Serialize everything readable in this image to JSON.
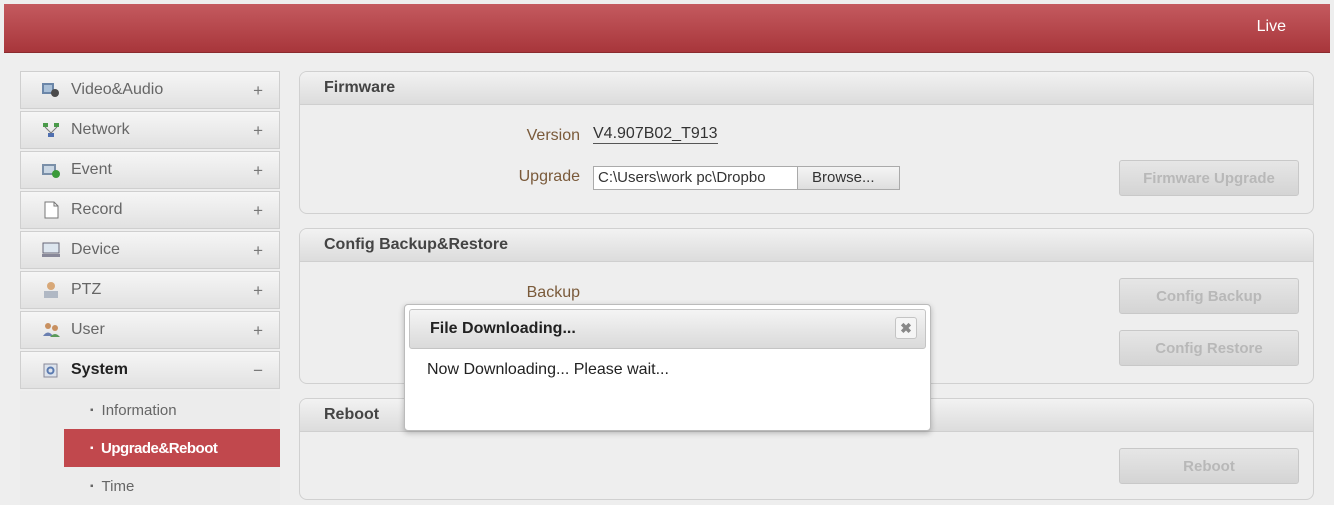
{
  "topbar": {
    "live_label": "Live"
  },
  "sidebar": {
    "items": [
      {
        "label": "Video&Audio",
        "toggle": "+",
        "icon": "video-audio-icon"
      },
      {
        "label": "Network",
        "toggle": "+",
        "icon": "network-icon"
      },
      {
        "label": "Event",
        "toggle": "+",
        "icon": "event-icon"
      },
      {
        "label": "Record",
        "toggle": "+",
        "icon": "record-icon"
      },
      {
        "label": "Device",
        "toggle": "+",
        "icon": "device-icon"
      },
      {
        "label": "PTZ",
        "toggle": "+",
        "icon": "ptz-icon"
      },
      {
        "label": "User",
        "toggle": "+",
        "icon": "user-icon"
      },
      {
        "label": "System",
        "toggle": "−",
        "icon": "system-icon"
      }
    ],
    "subitems": [
      {
        "label": "Information"
      },
      {
        "label": "Upgrade&Reboot"
      },
      {
        "label": "Time"
      }
    ]
  },
  "firmware": {
    "title": "Firmware",
    "version_label": "Version",
    "version_value": "V4.907B02_T913",
    "upgrade_label": "Upgrade",
    "file_path": "C:\\Users\\work pc\\Dropbo",
    "browse_label": "Browse...",
    "upgrade_button": "Firmware Upgrade"
  },
  "config": {
    "title": "Config Backup&Restore",
    "backup_label": "Backup",
    "backup_button": "Config Backup",
    "restore_button": "Config Restore"
  },
  "reboot": {
    "title": "Reboot",
    "reboot_button": "Reboot"
  },
  "dialog": {
    "title": "File Downloading...",
    "close": "✖",
    "message": "Now Downloading... Please wait..."
  },
  "colors": {
    "accent": "#b8454a",
    "active_sub": "#c1484d"
  }
}
